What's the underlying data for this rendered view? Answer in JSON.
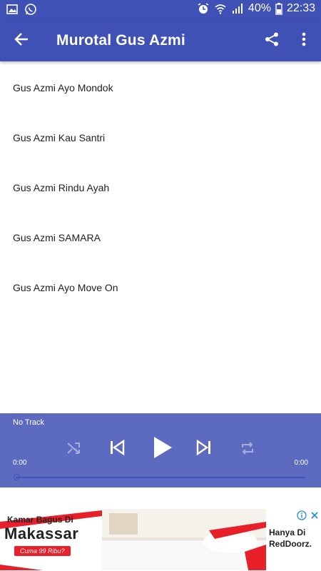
{
  "status_bar": {
    "battery": "40%",
    "time": "22:33",
    "left_icons": [
      "gallery-icon",
      "whatsapp-icon"
    ],
    "right_icons": [
      "alarm-icon",
      "wifi-icon",
      "signal-icon",
      "battery-icon"
    ]
  },
  "app_bar": {
    "title": "Murotal Gus Azmi",
    "background": "#3F51B5",
    "icons": [
      "back-arrow-icon",
      "share-icon",
      "more-vert-icon"
    ]
  },
  "tracks": [
    "Gus Azmi Ayo Mondok",
    "Gus Azmi Kau Santri",
    "Gus Azmi Rindu Ayah",
    "Gus Azmi SAMARA",
    "Gus Azmi  Ayo Move On"
  ],
  "player": {
    "now_playing": "No Track",
    "time_elapsed": "0:00",
    "time_total": "0:00",
    "background": "#5C6BC0",
    "progress": 0,
    "controls": [
      "shuffle-icon",
      "previous-icon",
      "play-icon",
      "next-icon",
      "repeat-icon"
    ]
  },
  "ad": {
    "headline_small": "Kamar Bagus Di",
    "headline_big": "Makassar",
    "pill": "Cuma 99 Ribu?",
    "right_line1": "Hanya Di",
    "right_line2": "RedDoorz.",
    "accent": "#e8202a",
    "icons": [
      "ad-info-icon",
      "ad-close-icon"
    ]
  }
}
